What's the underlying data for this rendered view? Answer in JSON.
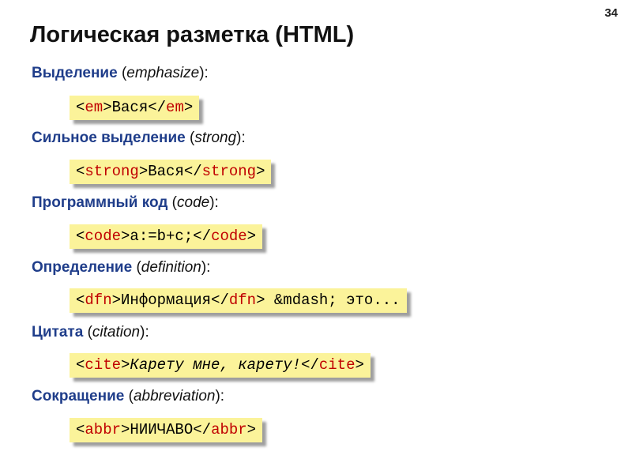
{
  "page_number": "34",
  "title": "Логическая разметка (HTML)",
  "items": [
    {
      "ru": "Выделение",
      "en": "emphasize",
      "pre": "<",
      "tag": "em",
      "mid": ">",
      "text": "Вася",
      "close": "</",
      "tag2": "em",
      "end": ">"
    },
    {
      "ru": "Сильное выделение",
      "en": "strong",
      "pre": "<",
      "tag": "strong",
      "mid": ">",
      "text": "Вася",
      "close": "</",
      "tag2": "strong",
      "end": ">"
    },
    {
      "ru": "Программный код",
      "en": "code",
      "pre": "<",
      "tag": "code",
      "mid": ">",
      "text": "a:=b+c;",
      "close": "</",
      "tag2": "code",
      "end": ">"
    },
    {
      "ru": "Определение",
      "en": "definition",
      "pre": "<",
      "tag": "dfn",
      "mid": ">",
      "text": "Информация",
      "close": "</",
      "tag2": "dfn",
      "end": "> &mdash; это..."
    },
    {
      "ru": "Цитата",
      "en": "citation",
      "pre": "<",
      "tag": "cite",
      "mid": ">",
      "text": "Карету мне, карету!",
      "close": "</",
      "tag2": "cite",
      "end": ">"
    },
    {
      "ru": "Сокращение",
      "en": "abbreviation",
      "pre": "<",
      "tag": "abbr",
      "mid": ">",
      "text": "НИИЧАВО",
      "close": "</",
      "tag2": "abbr",
      "end": ">"
    }
  ],
  "punct": {
    "open": " (",
    "close": "):"
  },
  "colors": {
    "heading": "#1f3d8a",
    "tag": "#c00000",
    "box": "#fbf39a"
  }
}
